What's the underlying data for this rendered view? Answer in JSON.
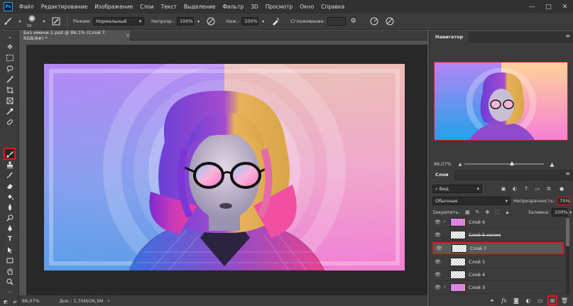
{
  "menubar": {
    "app_logo": "Ps",
    "items": [
      "Файл",
      "Редактирование",
      "Изображение",
      "Слои",
      "Текст",
      "Выделение",
      "Фильтр",
      "3D",
      "Просмотр",
      "Окно",
      "Справка"
    ],
    "window_controls": [
      "—",
      "□",
      "✕"
    ]
  },
  "options": {
    "brush_size": "59",
    "mode_label": "Режим:",
    "mode_value": "Нормальный",
    "opacity_label": "Непрозр.:",
    "opacity_value": "100%",
    "flow_label": "Наж.:",
    "flow_value": "100%",
    "smoothing_label": "Сглаживание:",
    "smoothing_value": ""
  },
  "document": {
    "tab_title": "Без имени-1.psd @ 86,1% (Слой 7, RGB/8#) *",
    "tab_close": "×"
  },
  "statusbar": {
    "zoom": "86,07%",
    "doc_size": "Док.: 1,70M/26,3M",
    "arrow": "›"
  },
  "navigator": {
    "title": "Навигатор",
    "zoom": "86,07%"
  },
  "layers": {
    "title": "Слои",
    "filter_kind": "Вид",
    "blend_mode": "Обычные",
    "opacity_label": "Непрозрачность:",
    "opacity_value": "75%",
    "lock_label": "Закрепить:",
    "fill_label": "Заливка:",
    "fill_value": "100%",
    "items": [
      {
        "name": "Слой 6"
      },
      {
        "name": "Слой 5 копия"
      },
      {
        "name": "Слой 7"
      },
      {
        "name": "Слой 5"
      },
      {
        "name": "Слой 4"
      },
      {
        "name": "Слой 3"
      }
    ]
  },
  "colors": {
    "accent_red": "#d51e22",
    "foreground": "#f3d7a8",
    "background": "#ffffff"
  }
}
